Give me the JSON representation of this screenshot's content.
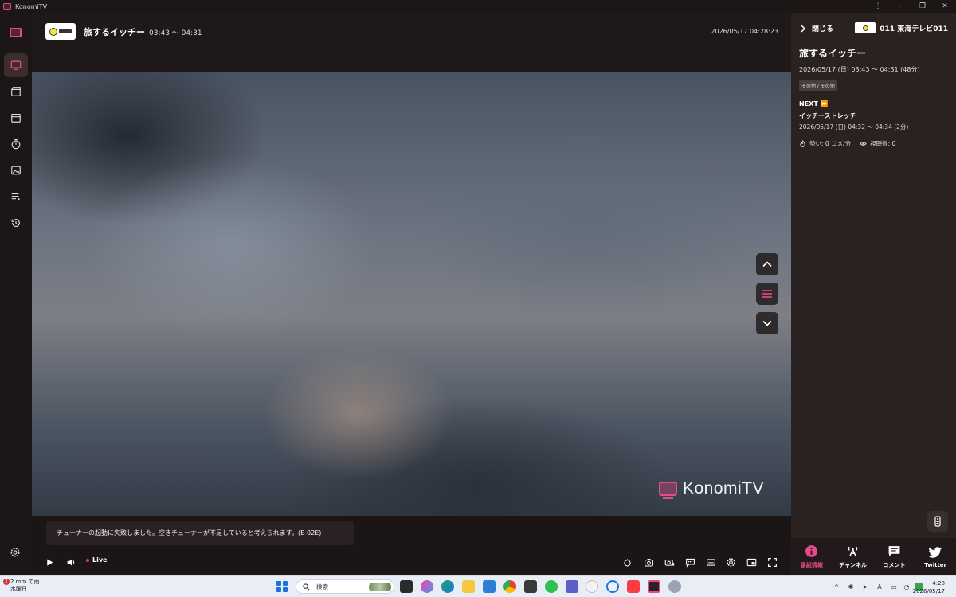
{
  "window": {
    "title": "KonomiTV"
  },
  "player": {
    "program_title": "旅するイッチー",
    "program_time": "03:43 〜 04:31",
    "current_datetime": "2026/05/17 04:28:23",
    "watermark": "KonomiTV",
    "error_toast": "チューナーの起動に失敗しました。空きチューナーが不足していると考えられます。(E-02E)",
    "live_label": "Live"
  },
  "panel": {
    "close_label": "閉じる",
    "channel_name": "011 東海テレビ011",
    "title": "旅するイッチー",
    "datetime": "2026/05/17 (日) 03:43 〜 04:31 (48分)",
    "genre": "その他 / その他",
    "next_label": "NEXT",
    "next_title": "イッチーストレッチ",
    "next_datetime": "2026/05/17 (日) 04:32 〜 04:34 (2分)",
    "momentum": "勢い: 0 コメ/分",
    "viewers": "視聴数: 0",
    "tabs": [
      {
        "label": "番組情報",
        "icon": "info-icon"
      },
      {
        "label": "チャンネル",
        "icon": "antenna-icon"
      },
      {
        "label": "コメント",
        "icon": "comment-icon"
      },
      {
        "label": "Twitter",
        "icon": "twitter-icon"
      }
    ]
  },
  "taskbar": {
    "weather_line1": "2 mm の雨",
    "weather_line2": "水曜日",
    "notification_count": "2",
    "search_placeholder": "検索",
    "time": "4:28",
    "date": "2026/05/17"
  },
  "colors": {
    "accent": "#e64a8b",
    "background": "#0f0b0b",
    "panel": "#2a2121"
  }
}
